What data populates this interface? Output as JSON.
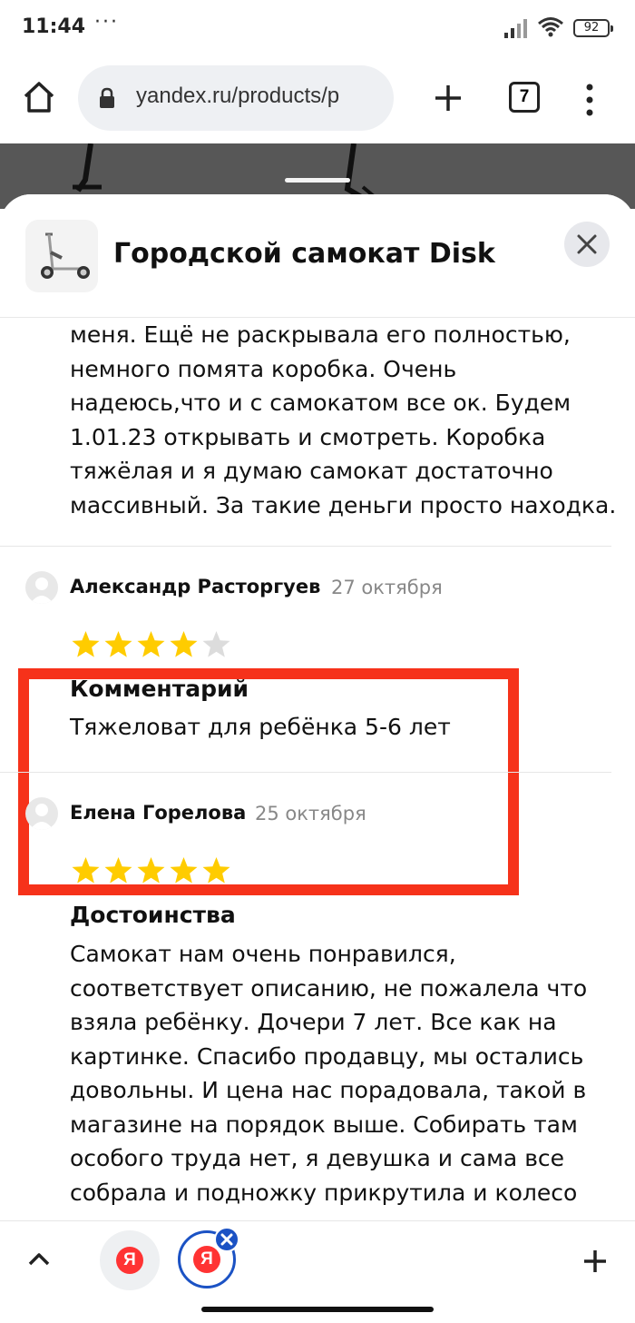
{
  "status_bar": {
    "time": "11:44",
    "dots": "···",
    "battery": "92"
  },
  "browser": {
    "url": "yandex.ru/products/p",
    "tab_count": "7",
    "icons": [
      "home-icon",
      "lock-icon",
      "new-tab-plus-icon",
      "tabs-counter-icon",
      "more-vert-icon"
    ]
  },
  "sheet": {
    "product_title": "Городской самокат Disk",
    "close_icon": "close-icon"
  },
  "reviews": {
    "continued_text_lines": [
      "меня. Ещё не раскрывала его полностью,",
      "немного помята коробка. Очень",
      "надеюсь,что и с самокатом все ок. Будем",
      "1.01.23 открывать и смотреть. Коробка",
      "тяжёлая и я думаю самокат достаточно",
      "массивный. За такие деньги просто находка."
    ],
    "items": [
      {
        "author": "Александр Расторгуев",
        "date": "27 октября",
        "rating": 4,
        "section_title": "Комментарий",
        "text_lines": [
          "Тяжеловат для ребёнка 5-6 лет"
        ]
      },
      {
        "author": "Елена Горелова",
        "date": "25 октября",
        "rating": 5,
        "section_title": "Достоинства",
        "text_lines": [
          "Самокат нам очень понравился,",
          "соответствует описанию, не пожалела что",
          "взяла ребёнку. Дочери 7 лет. Все как на",
          "картинке. Спасибо продавцу, мы остались",
          "довольны. И цена нас порадовала, такой в",
          "магазине на порядок выше. Собирать там",
          "особого труда нет, я девушка и сама все",
          "собрала и подножку прикрутила и колесо"
        ]
      }
    ]
  },
  "bottom_bar": {
    "ya_letter": "Я",
    "icons": [
      "chevron-up-icon",
      "yandex-tab-icon",
      "yandex-tab-active-icon",
      "tab-close-icon",
      "plus-icon"
    ]
  },
  "colors": {
    "highlight": "#f6321a",
    "star_filled": "#ffcc00",
    "star_empty": "#dcdcdc",
    "active_tab": "#1b52c4",
    "yandex_red": "#ff3333"
  }
}
